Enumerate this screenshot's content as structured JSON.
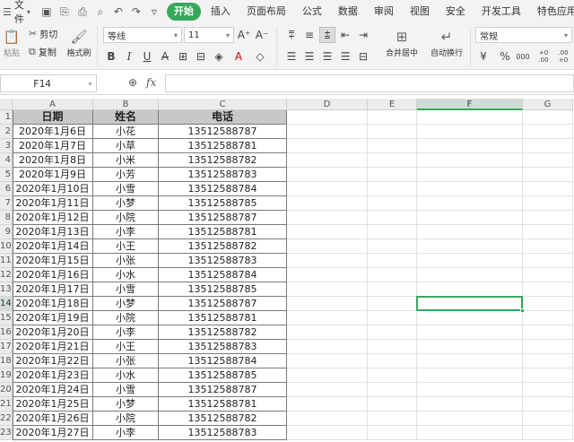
{
  "menubar": {
    "file_label": "文件",
    "menus": [
      "开始",
      "插入",
      "页面布局",
      "公式",
      "数据",
      "审阅",
      "视图",
      "安全",
      "开发工具",
      "特色应用"
    ],
    "active_menu": "开始",
    "accent_color": "#36a85b"
  },
  "ribbon": {
    "paste_label": "粘贴",
    "cut_label": "剪切",
    "copy_label": "复制",
    "format_painter_label": "格式刷",
    "font_name": "等线",
    "font_size": "11",
    "grow_font_label": "A⁺",
    "shrink_font_label": "A⁻",
    "bold_label": "B",
    "italic_label": "I",
    "underline_label": "U",
    "merge_center_label": "合并居中",
    "wrap_text_label": "自动换行",
    "number_format": "常规",
    "percent_label": "%",
    "thousands_label": "000",
    "inc_decimal_label": "+0 .00",
    "dec_decimal_label": ".00 +0"
  },
  "formula_bar": {
    "name_box": "F14",
    "fx_label": "fx",
    "formula": ""
  },
  "grid": {
    "columns": [
      "A",
      "B",
      "C",
      "D",
      "E",
      "F",
      "G"
    ],
    "selected_column": "F",
    "selected_row": 14,
    "active_cell": "F14",
    "rows": [
      {
        "n": "1",
        "a": "日期",
        "b": "姓名",
        "c": "电话"
      },
      {
        "n": "2",
        "a": "2020年1月6日",
        "b": "小花",
        "c": "13512588787"
      },
      {
        "n": "3",
        "a": "2020年1月7日",
        "b": "小草",
        "c": "13512588781"
      },
      {
        "n": "4",
        "a": "2020年1月8日",
        "b": "小米",
        "c": "13512588782"
      },
      {
        "n": "5",
        "a": "2020年1月9日",
        "b": "小芳",
        "c": "13512588783"
      },
      {
        "n": "6",
        "a": "2020年1月10日",
        "b": "小雪",
        "c": "13512588784"
      },
      {
        "n": "7",
        "a": "2020年1月11日",
        "b": "小梦",
        "c": "13512588785"
      },
      {
        "n": "8",
        "a": "2020年1月12日",
        "b": "小院",
        "c": "13512588787"
      },
      {
        "n": "9",
        "a": "2020年1月13日",
        "b": "小李",
        "c": "13512588781"
      },
      {
        "n": "10",
        "a": "2020年1月14日",
        "b": "小王",
        "c": "13512588782"
      },
      {
        "n": "11",
        "a": "2020年1月15日",
        "b": "小张",
        "c": "13512588783"
      },
      {
        "n": "12",
        "a": "2020年1月16日",
        "b": "小水",
        "c": "13512588784"
      },
      {
        "n": "13",
        "a": "2020年1月17日",
        "b": "小雪",
        "c": "13512588785"
      },
      {
        "n": "14",
        "a": "2020年1月18日",
        "b": "小梦",
        "c": "13512588787"
      },
      {
        "n": "15",
        "a": "2020年1月19日",
        "b": "小院",
        "c": "13512588781"
      },
      {
        "n": "16",
        "a": "2020年1月20日",
        "b": "小李",
        "c": "13512588782"
      },
      {
        "n": "17",
        "a": "2020年1月21日",
        "b": "小王",
        "c": "13512588783"
      },
      {
        "n": "18",
        "a": "2020年1月22日",
        "b": "小张",
        "c": "13512588784"
      },
      {
        "n": "19",
        "a": "2020年1月23日",
        "b": "小水",
        "c": "13512588785"
      },
      {
        "n": "20",
        "a": "2020年1月24日",
        "b": "小雪",
        "c": "13512588787"
      },
      {
        "n": "21",
        "a": "2020年1月25日",
        "b": "小梦",
        "c": "13512588781"
      },
      {
        "n": "22",
        "a": "2020年1月26日",
        "b": "小院",
        "c": "13512588782"
      },
      {
        "n": "23",
        "a": "2020年1月27日",
        "b": "小李",
        "c": "13512588783"
      }
    ]
  }
}
